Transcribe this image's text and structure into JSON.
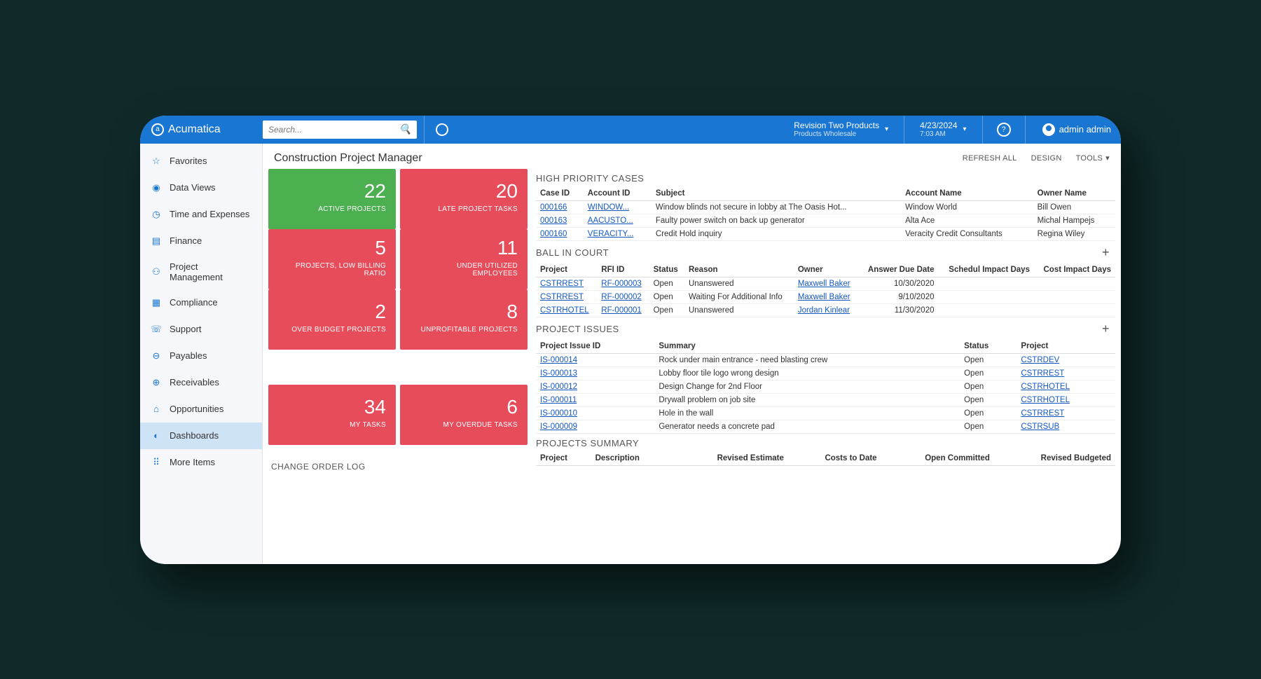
{
  "brand": "Acumatica",
  "search": {
    "placeholder": "Search..."
  },
  "env": {
    "name": "Revision Two Products",
    "sub": "Products Wholesale"
  },
  "datetime": {
    "date": "4/23/2024",
    "time": "7:03 AM"
  },
  "user": {
    "name": "admin admin"
  },
  "sidebar": {
    "items": [
      {
        "label": "Favorites",
        "icon": "star"
      },
      {
        "label": "Data Views",
        "icon": "eye"
      },
      {
        "label": "Time and Expenses",
        "icon": "clock"
      },
      {
        "label": "Finance",
        "icon": "calc"
      },
      {
        "label": "Project Management",
        "icon": "people"
      },
      {
        "label": "Compliance",
        "icon": "doc"
      },
      {
        "label": "Support",
        "icon": "headset"
      },
      {
        "label": "Payables",
        "icon": "minus"
      },
      {
        "label": "Receivables",
        "icon": "plus"
      },
      {
        "label": "Opportunities",
        "icon": "tag"
      },
      {
        "label": "Dashboards",
        "icon": "gauge",
        "active": true
      },
      {
        "label": "More Items",
        "icon": "grid"
      }
    ]
  },
  "page": {
    "title": "Construction Project Manager",
    "actions": {
      "refresh": "REFRESH ALL",
      "design": "DESIGN",
      "tools": "TOOLS"
    }
  },
  "kpis": [
    [
      {
        "value": "22",
        "label": "ACTIVE PROJECTS",
        "color": "green"
      },
      {
        "value": "20",
        "label": "LATE PROJECT TASKS",
        "color": "red"
      }
    ],
    [
      {
        "value": "5",
        "label": "PROJECTS, LOW BILLING RATIO",
        "color": "red"
      },
      {
        "value": "11",
        "label": "UNDER UTILIZED EMPLOYEES",
        "color": "red"
      }
    ],
    [
      {
        "value": "2",
        "label": "OVER BUDGET PROJECTS",
        "color": "red"
      },
      {
        "value": "8",
        "label": "UNPROFITABLE PROJECTS",
        "color": "red"
      }
    ],
    [
      {
        "value": "34",
        "label": "MY TASKS",
        "color": "red"
      },
      {
        "value": "6",
        "label": "MY OVERDUE TASKS",
        "color": "red"
      }
    ]
  ],
  "change_order_heading": "CHANGE ORDER LOG",
  "high_priority": {
    "title": "HIGH PRIORITY CASES",
    "headers": [
      "Case ID",
      "Account ID",
      "Subject",
      "Account Name",
      "Owner Name"
    ],
    "rows": [
      {
        "case": "000166",
        "acct": "WINDOW...",
        "subject": "Window blinds not secure in lobby at The Oasis Hot...",
        "acctname": "Window World",
        "owner": "Bill Owen"
      },
      {
        "case": "000163",
        "acct": "AACUSTO...",
        "subject": "Faulty power switch on back up generator",
        "acctname": "Alta Ace",
        "owner": "Michal Hampejs"
      },
      {
        "case": "000160",
        "acct": "VERACITY...",
        "subject": "Credit Hold inquiry",
        "acctname": "Veracity Credit Consultants",
        "owner": "Regina Wiley"
      }
    ]
  },
  "ball_in_court": {
    "title": "BALL IN COURT",
    "headers": [
      "Project",
      "RFI ID",
      "Status",
      "Reason",
      "Owner",
      "Answer Due Date",
      "Schedul Impact Days",
      "Cost Impact Days"
    ],
    "rows": [
      {
        "project": "CSTRREST",
        "rfi": "RF-000003",
        "status": "Open",
        "reason": "Unanswered",
        "owner": "Maxwell Baker",
        "due": "10/30/2020"
      },
      {
        "project": "CSTRREST",
        "rfi": "RF-000002",
        "status": "Open",
        "reason": "Waiting For Additional Info",
        "owner": "Maxwell Baker",
        "due": "9/10/2020"
      },
      {
        "project": "CSTRHOTEL",
        "rfi": "RF-000001",
        "status": "Open",
        "reason": "Unanswered",
        "owner": "Jordan Kinlear",
        "due": "11/30/2020"
      }
    ]
  },
  "project_issues": {
    "title": "PROJECT ISSUES",
    "headers": [
      "Project Issue ID",
      "Summary",
      "Status",
      "Project"
    ],
    "rows": [
      {
        "id": "IS-000014",
        "summary": "Rock under main entrance - need blasting crew",
        "status": "Open",
        "project": "CSTRDEV"
      },
      {
        "id": "IS-000013",
        "summary": "Lobby floor tile logo wrong design",
        "status": "Open",
        "project": "CSTRREST"
      },
      {
        "id": "IS-000012",
        "summary": "Design Change for 2nd Floor",
        "status": "Open",
        "project": "CSTRHOTEL"
      },
      {
        "id": "IS-000011",
        "summary": "Drywall problem on job site",
        "status": "Open",
        "project": "CSTRHOTEL"
      },
      {
        "id": "IS-000010",
        "summary": "Hole in the wall",
        "status": "Open",
        "project": "CSTRREST"
      },
      {
        "id": "IS-000009",
        "summary": "Generator needs a concrete pad",
        "status": "Open",
        "project": "CSTRSUB"
      }
    ]
  },
  "projects_summary": {
    "title": "PROJECTS SUMMARY",
    "headers": [
      "Project",
      "Description",
      "Revised Estimate",
      "Costs to Date",
      "Open Committed",
      "Revised Budgeted"
    ]
  }
}
